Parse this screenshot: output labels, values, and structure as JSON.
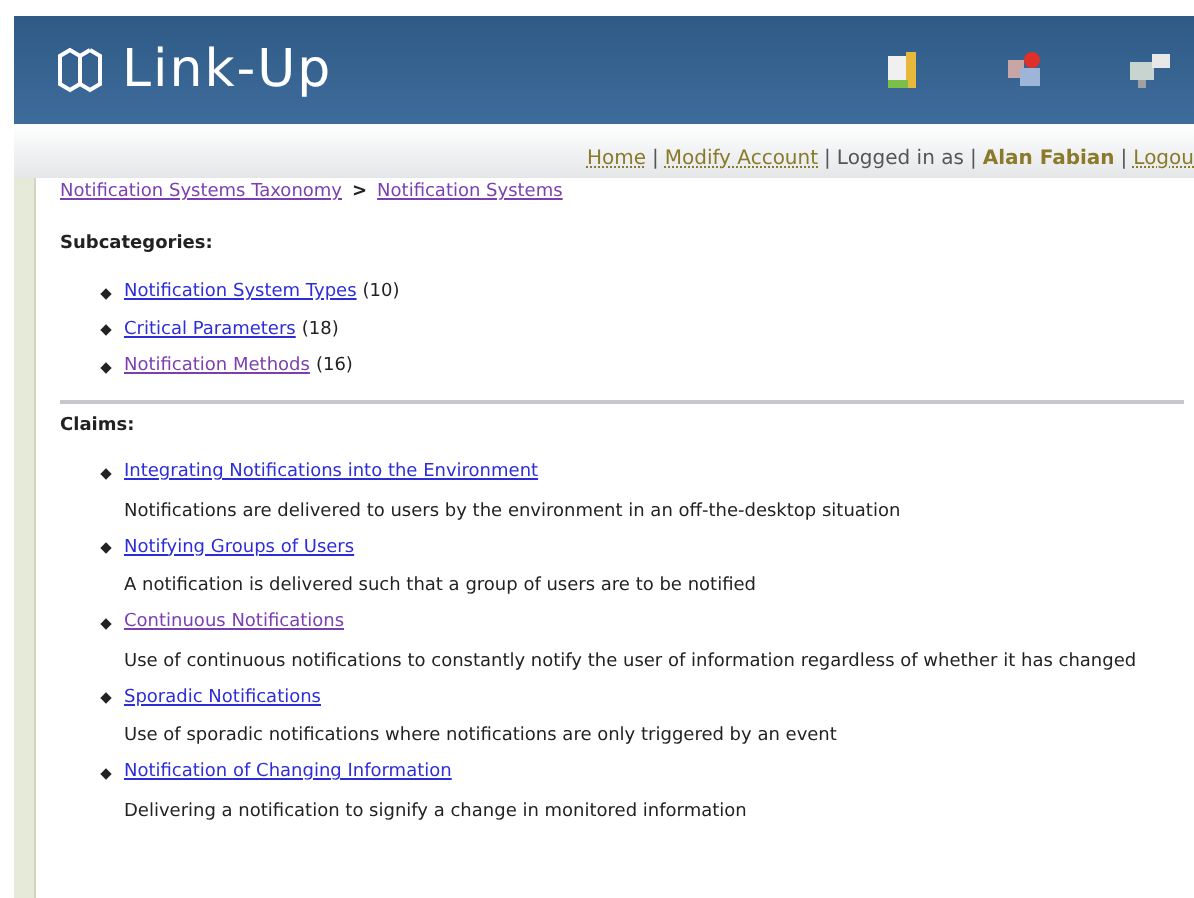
{
  "header": {
    "logo": "Link-Up"
  },
  "user_bar": {
    "separator": "|",
    "links": [
      {
        "label": "Home",
        "kind": "link"
      },
      {
        "label": "Modify Account",
        "kind": "link"
      },
      {
        "label": "Logged in as",
        "kind": "text"
      },
      {
        "label": "Alan Fabian",
        "kind": "user"
      },
      {
        "label": "Logou",
        "kind": "link"
      }
    ]
  },
  "breadcrumbs": [
    {
      "label": "Notification Systems Taxonomy",
      "visited": true
    },
    {
      "label": "Notification Systems",
      "visited": true
    }
  ],
  "breadcrumb_separator": ">",
  "subcategories": {
    "title": "Subcategories:",
    "items": [
      {
        "label": "Notification System Types",
        "count": "(10)",
        "visited": false
      },
      {
        "label": "Critical Parameters",
        "count": "(18)",
        "visited": false
      },
      {
        "label": "Notification Methods",
        "count": "(16)",
        "visited": true
      }
    ]
  },
  "claims": {
    "title": "Claims:",
    "items": [
      {
        "label": "Integrating Notifications into the Environment",
        "description": "Notifications are delivered to users by the environment in an off-the-desktop situation",
        "visited": false
      },
      {
        "label": "Notifying Groups of Users",
        "description": "A notification is delivered such that a group of users are to be notified",
        "visited": false
      },
      {
        "label": "Continuous Notifications",
        "description": "Use of continuous notifications to constantly notify the user of information regardless of whether it has changed",
        "visited": true
      },
      {
        "label": "Sporadic Notifications",
        "description": "Use of sporadic notifications where notifications are only triggered by an event",
        "visited": false
      },
      {
        "label": "Notification of Changing Information",
        "description": "Delivering a notification to signify a change in monitored information",
        "visited": false
      }
    ]
  }
}
